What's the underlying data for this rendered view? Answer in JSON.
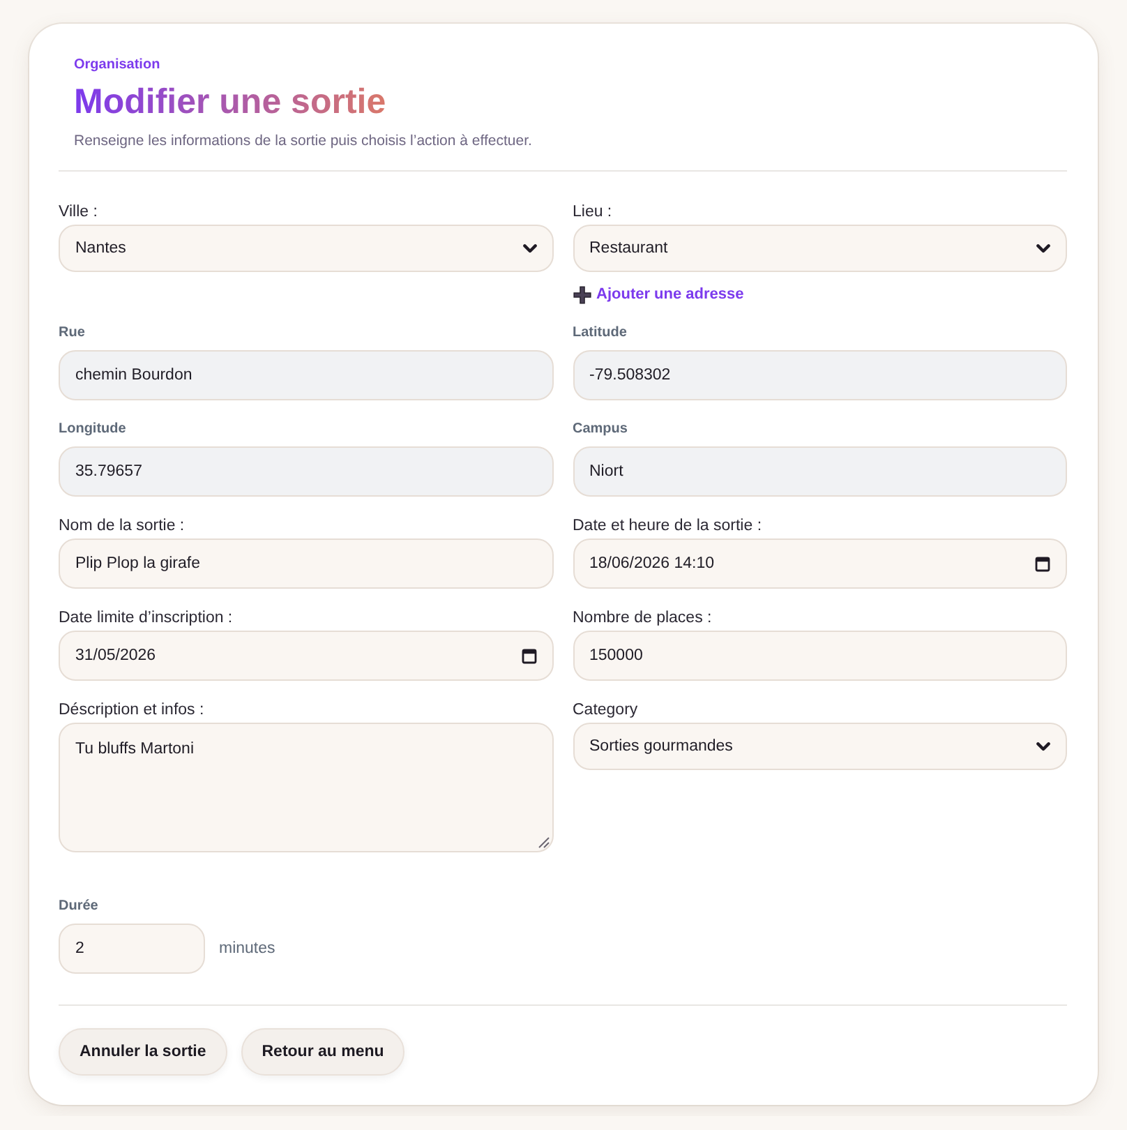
{
  "header": {
    "eyebrow": "Organisation",
    "title": "Modifier une sortie",
    "subtitle": "Renseigne les informations de la sortie puis choisis l’action à effectuer."
  },
  "fields": [
    {
      "kind": "select",
      "label": "Ville :",
      "value": "Nantes"
    },
    {
      "kind": "select",
      "label": "Lieu :",
      "value": "Restaurant",
      "link": "Ajouter une adresse"
    },
    {
      "kind": "readonly",
      "label": "Rue",
      "value": "chemin Bourdon"
    },
    {
      "kind": "readonly",
      "label": "Latitude",
      "value": "-79.508302"
    },
    {
      "kind": "readonly",
      "label": "Longitude",
      "value": "35.79657"
    },
    {
      "kind": "readonly",
      "label": "Campus",
      "value": "Niort"
    },
    {
      "kind": "text",
      "label": "Nom de la sortie :",
      "value": "Plip Plop la girafe"
    },
    {
      "kind": "date",
      "label": "Date et heure de la sortie :",
      "value": "18/06/2026 14:10"
    },
    {
      "kind": "date",
      "label": "Date limite d’inscription :",
      "value": "31/05/2026"
    },
    {
      "kind": "text",
      "label": "Nombre de places :",
      "value": "150000"
    },
    {
      "kind": "textarea",
      "label": "Déscription et infos :",
      "value": "Tu bluffs Martoni"
    },
    {
      "kind": "select",
      "label": "Category",
      "value": "Sorties gourmandes"
    }
  ],
  "duration": {
    "label": "Durée",
    "value": "2",
    "unit": "minutes"
  },
  "buttons": [
    "Annuler la sortie",
    "Retour au menu"
  ]
}
